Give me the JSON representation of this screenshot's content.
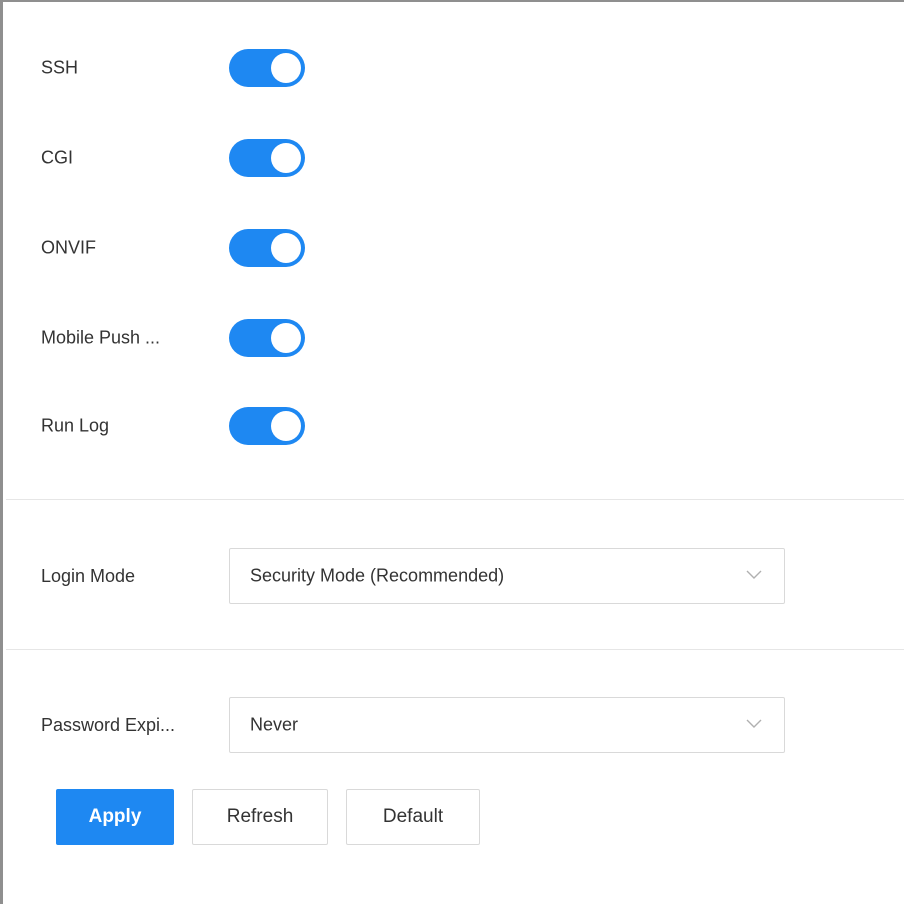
{
  "toggles": [
    {
      "label": "SSH",
      "on": true
    },
    {
      "label": "CGI",
      "on": true
    },
    {
      "label": "ONVIF",
      "on": true
    },
    {
      "label": "Mobile Push ...",
      "on": true
    },
    {
      "label": "Run Log",
      "on": true
    }
  ],
  "login_mode": {
    "label": "Login Mode",
    "value": "Security Mode (Recommended)"
  },
  "password_expiry": {
    "label": "Password Expi...",
    "value": "Never"
  },
  "buttons": {
    "apply": "Apply",
    "refresh": "Refresh",
    "default": "Default"
  },
  "colors": {
    "accent": "#1e88f2",
    "border": "#d9d9d9",
    "text": "#333333"
  },
  "icons": {
    "select_arrow": "chevron-down-icon"
  }
}
